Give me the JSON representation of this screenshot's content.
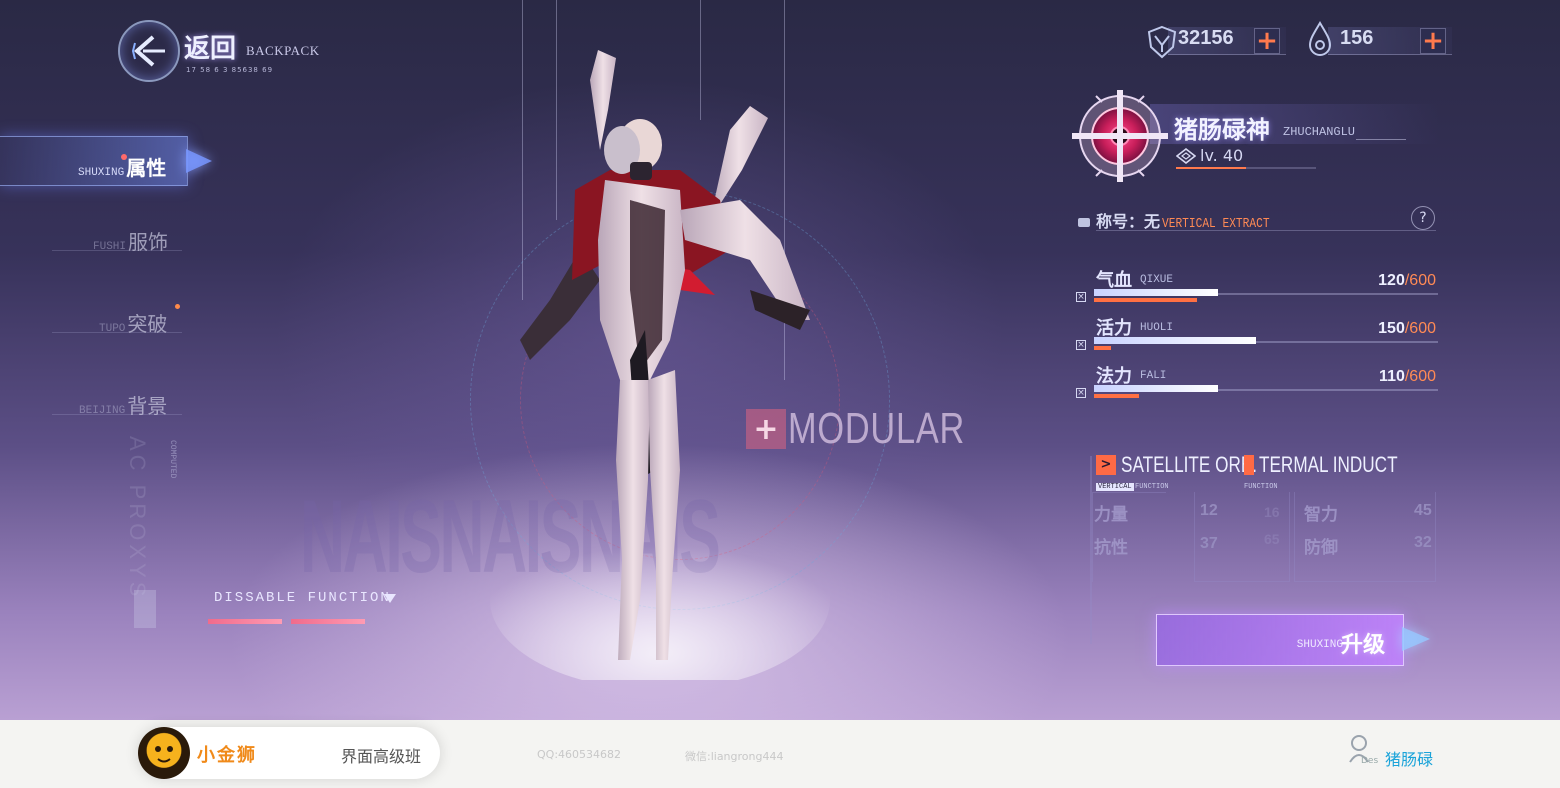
{
  "header": {
    "back_label": "返回",
    "back_sub": "BACKPACK",
    "back_code": "17     58 6        3    85638  69"
  },
  "nav": {
    "items": [
      {
        "pinyin": "SHUXING",
        "label": "属性",
        "active": true
      },
      {
        "pinyin": "FUSHI",
        "label": "服饰",
        "active": false
      },
      {
        "pinyin": "TUPO",
        "label": "突破",
        "active": false
      },
      {
        "pinyin": "BEIJING",
        "label": "背景",
        "active": false
      }
    ]
  },
  "decor": {
    "watermark": "NAISNAISNAIS",
    "vertical": "AC PROXYS",
    "vertical_small": "COMPUTED",
    "modular_mark": "+",
    "modular": "MODULAR"
  },
  "dissable": {
    "label": "DISSABLE FUNCTION",
    "bars": [
      1,
      1
    ]
  },
  "currency": {
    "coins": "32156",
    "drops": "156",
    "plus": "+"
  },
  "character": {
    "name": "猪肠碌神",
    "pinyin": "ZHUCHANGLU",
    "level": "lv. 40",
    "level_progress": 0.5,
    "title_label": "称号：",
    "title_value": "无",
    "title_extra": "VERTICAL EXTRACT",
    "help": "?"
  },
  "stats": [
    {
      "cn": "气血",
      "py": "QIXUE",
      "value": "120",
      "max": "/600",
      "fill": 0.36,
      "sub": 0.3
    },
    {
      "cn": "活力",
      "py": "HUOLI",
      "value": "150",
      "max": "/600",
      "fill": 0.47,
      "sub": 0.05
    },
    {
      "cn": "法力",
      "py": "FALI",
      "value": "110",
      "max": "/600",
      "fill": 0.36,
      "sub": 0.13
    }
  ],
  "satellite": {
    "icon": ">",
    "orb": "SATELLITE ORB.",
    "termal": "TERMAL INDUCT",
    "tag1": "VERTICAL",
    "tag2": "FUNCTION",
    "tag3": "FUNCTION"
  },
  "attributes": {
    "li": {
      "label": "力量",
      "value": "12",
      "value2": "16"
    },
    "kang": {
      "label": "抗性",
      "value": "37",
      "value2": "65"
    },
    "zhi": {
      "label": "智力",
      "value": "45"
    },
    "fang": {
      "label": "防御",
      "value": "32"
    }
  },
  "upgrade": {
    "pinyin": "SHUXING",
    "label": "升级"
  },
  "footer": {
    "brand": "小金狮",
    "course": "界面高级班",
    "qq": "QQ:460534682",
    "wechat": "微信:liangrong444",
    "des": "Des",
    "user": "猪肠碌"
  },
  "colors": {
    "accent_orange": "#ff7a4d",
    "accent_blue": "#8aa0ff",
    "upgrade_purple": "#b07cf0",
    "footer_user": "#1aa3d9"
  }
}
